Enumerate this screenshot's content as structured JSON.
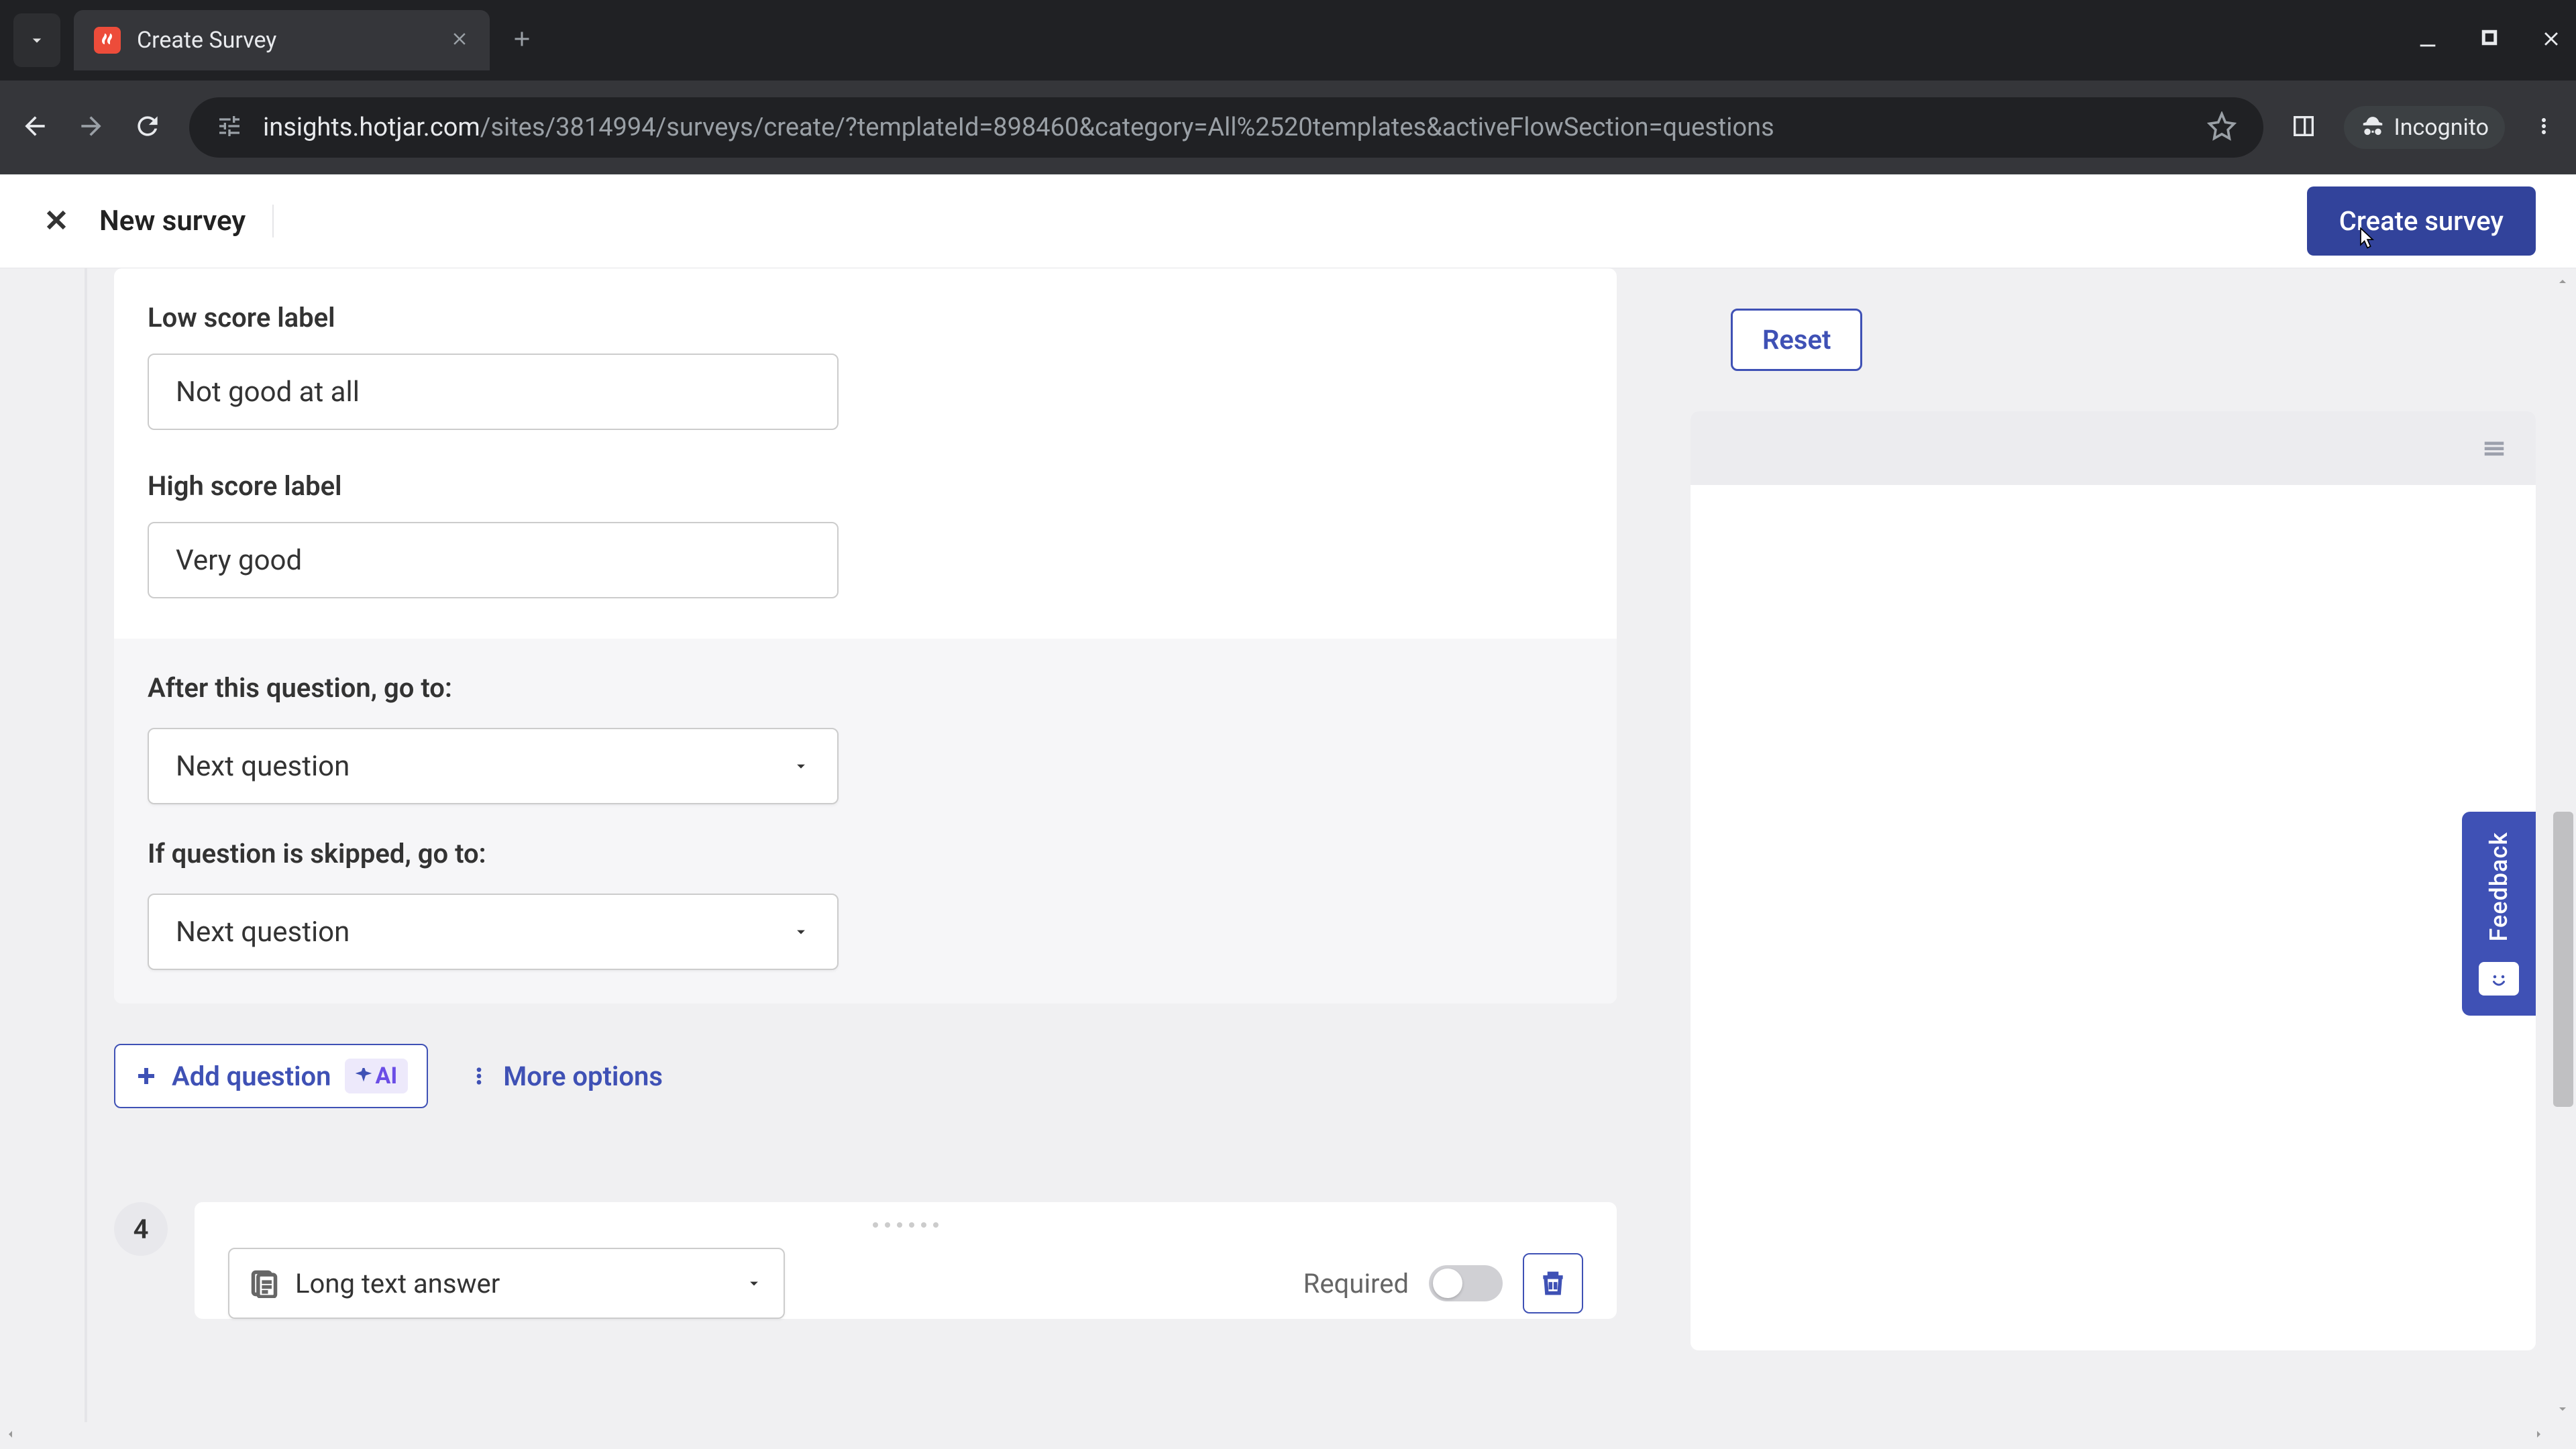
{
  "browser": {
    "tab_title": "Create Survey",
    "url_host": "insights.hotjar.com",
    "url_path": "/sites/3814994/surveys/create/?templateId=898460&category=All%2520templates&activeFlowSection=questions",
    "incognito_label": "Incognito"
  },
  "header": {
    "title": "New survey",
    "create_button": "Create survey"
  },
  "form": {
    "low_score_label": "Low score label",
    "low_score_value": "Not good at all",
    "high_score_label": "High score label",
    "high_score_value": "Very good",
    "after_question_label": "After this question, go to:",
    "after_question_value": "Next question",
    "skipped_label": "If question is skipped, go to:",
    "skipped_value": "Next question"
  },
  "actions": {
    "add_question": "Add question",
    "ai_badge": "AI",
    "more_options": "More options"
  },
  "q4": {
    "number": "4",
    "type": "Long text answer",
    "required_label": "Required"
  },
  "preview": {
    "reset": "Reset"
  },
  "feedback": {
    "label": "Feedback"
  }
}
